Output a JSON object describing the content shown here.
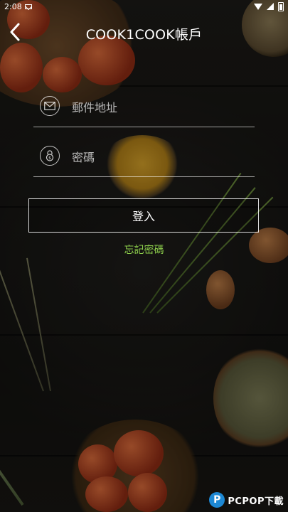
{
  "status_bar": {
    "time": "2:08"
  },
  "header": {
    "title": "COOK1COOK帳戶"
  },
  "form": {
    "email_placeholder": "郵件地址",
    "password_placeholder": "密碼",
    "login_label": "登入",
    "forgot_label": "忘記密碼"
  },
  "watermark": {
    "badge": "P",
    "text": "PCPOP下載"
  },
  "colors": {
    "accent_link": "#8ed04c",
    "background": "#1c1b18"
  },
  "icons": {
    "back": "chevron-left-icon",
    "email": "envelope-icon",
    "password": "lock-icon"
  }
}
